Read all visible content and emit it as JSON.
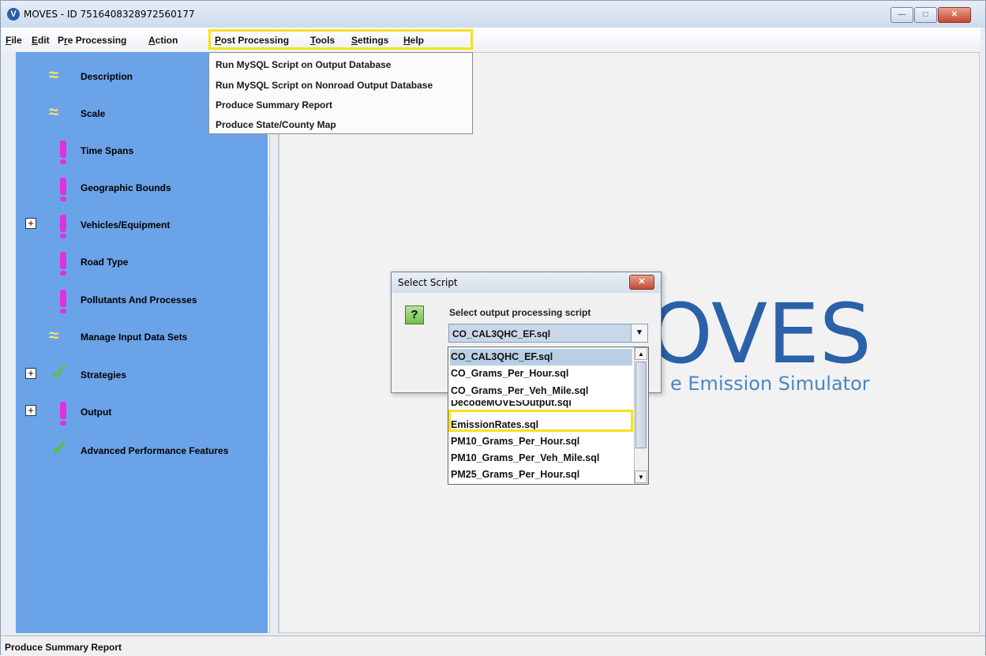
{
  "window": {
    "title": "MOVES - ID 7516408328972560177",
    "app_icon": "V",
    "buttons": [
      "minimize",
      "maximize",
      "close"
    ]
  },
  "menubar": {
    "items": [
      {
        "label": "File",
        "underline": "F",
        "rest": "ile"
      },
      {
        "label": "Edit",
        "underline": "E",
        "rest": "dit"
      },
      {
        "label": "Pre Processing",
        "pre": "P",
        "underline": "r",
        "rest": "e Processing"
      },
      {
        "label": "Action",
        "underline": "A",
        "rest": "ction"
      },
      {
        "label": "Post Processing",
        "underline": "P",
        "rest": "ost Processing",
        "active": true
      },
      {
        "label": "Tools",
        "underline": "T",
        "rest": "ools"
      },
      {
        "label": "Settings",
        "underline": "S",
        "rest": "ettings"
      },
      {
        "label": "Help",
        "underline": "H",
        "rest": "elp"
      }
    ]
  },
  "post_processing_menu": {
    "items": [
      "Run MySQL Script on Output Database",
      "Run MySQL Script on Nonroad Output Database",
      "Produce Summary Report",
      "Produce State/County Map"
    ]
  },
  "sidebar": {
    "items": [
      {
        "label": "Description",
        "status_icon": "approx-icon",
        "expandable": false
      },
      {
        "label": "Scale",
        "status_icon": "approx-icon",
        "expandable": false
      },
      {
        "label": "Time Spans",
        "status_icon": "exclamation-icon",
        "expandable": false
      },
      {
        "label": "Geographic Bounds",
        "status_icon": "exclamation-icon",
        "expandable": false
      },
      {
        "label": "Vehicles/Equipment",
        "status_icon": "exclamation-icon",
        "expandable": true
      },
      {
        "label": "Road Type",
        "status_icon": "exclamation-icon",
        "expandable": false
      },
      {
        "label": "Pollutants And Processes",
        "status_icon": "exclamation-icon",
        "expandable": false
      },
      {
        "label": "Manage Input Data Sets",
        "status_icon": "approx-icon",
        "expandable": false
      },
      {
        "label": "Strategies",
        "status_icon": "checkmark-icon",
        "expandable": true
      },
      {
        "label": "Output",
        "status_icon": "exclamation-icon",
        "expandable": true
      },
      {
        "label": "Advanced Performance Features",
        "status_icon": "checkmark-icon",
        "expandable": false
      }
    ]
  },
  "logo": {
    "text": "OVES",
    "subtitle": "e Emission Simulator"
  },
  "dialog": {
    "title": "Select Script",
    "prompt": "Select output processing script",
    "selected": "CO_CAL3QHC_EF.sql",
    "options": [
      "CO_CAL3QHC_EF.sql",
      "CO_Grams_Per_Hour.sql",
      "CO_Grams_Per_Veh_Mile.sql",
      "DecodeMOVESOutput.sql",
      "EmissionRates.sql",
      "PM10_Grams_Per_Hour.sql",
      "PM10_Grams_Per_Veh_Mile.sql",
      "PM25_Grams_Per_Hour.sql"
    ]
  },
  "statusbar": {
    "text": "Produce Summary Report"
  },
  "colors": {
    "sidebar_bg": "#6ba3e8",
    "highlight": "#f6e11c",
    "logo_blue": "#2b61a8"
  }
}
